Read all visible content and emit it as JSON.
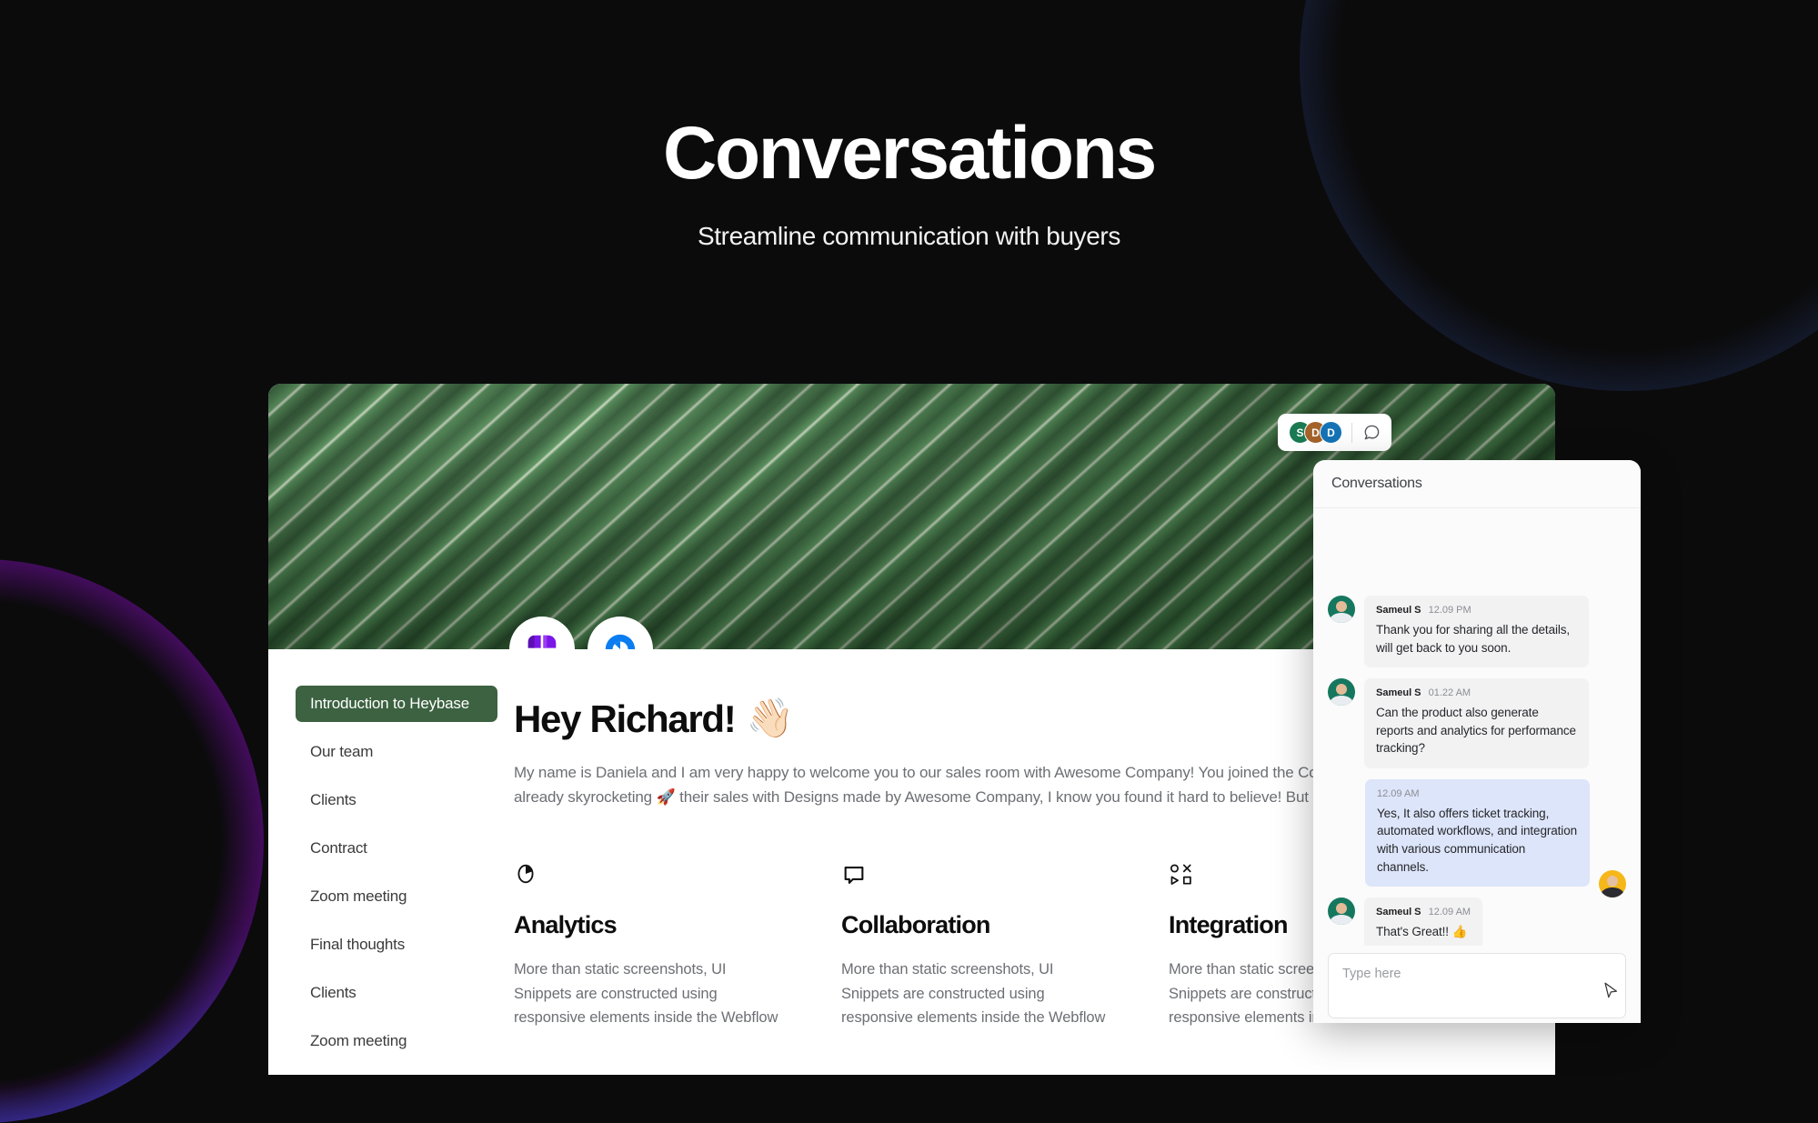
{
  "hero": {
    "title": "Conversations",
    "subtitle": "Streamline communication with buyers"
  },
  "colors": {
    "page_background": "#0b0b0c",
    "active_nav": "#3c6241",
    "outgoing_bubble": "#dde5fa",
    "incoming_bubble": "#f2f2f3",
    "banner_green": "#3f7543",
    "logo_purple": "#7b16e8",
    "logo_blue": "#0b7df0"
  },
  "banner": {
    "presence": {
      "avatars": [
        {
          "initial": "S",
          "color": "#1a7a52"
        },
        {
          "initial": "D",
          "color": "#a4622a"
        },
        {
          "initial": "D",
          "color": "#1573b5"
        }
      ],
      "chat_icon": "chat-bubble-icon"
    },
    "logos": [
      {
        "name": "heybase-logo",
        "icon": "clover-grid-icon"
      },
      {
        "name": "partner-logo",
        "icon": "blue-circle-icon"
      }
    ]
  },
  "sidebar": {
    "items": [
      {
        "label": "Introduction to Heybase",
        "active": true
      },
      {
        "label": "Our team",
        "active": false
      },
      {
        "label": "Clients",
        "active": false
      },
      {
        "label": "Contract",
        "active": false
      },
      {
        "label": "Zoom meeting",
        "active": false
      },
      {
        "label": "Final thoughts",
        "active": false
      },
      {
        "label": "Clients",
        "active": false
      },
      {
        "label": "Zoom meeting",
        "active": false
      }
    ]
  },
  "content": {
    "greeting": "Hey Richard!",
    "greeting_emoji": "👋🏻",
    "intro": "My name is Daniela and I am very happy to welcome you to our sales room with Awesome Company! You joined the Companies who are already skyrocketing 🚀 their sales with Designs made by Awesome Company, I know you found it hard to believe! But it is possible.",
    "features": [
      {
        "icon": "pie-chart-icon",
        "title": "Analytics",
        "body": "More than static screenshots, UI Snippets are constructed using responsive elements inside the Webflow"
      },
      {
        "icon": "speech-bubble-icon",
        "title": "Collaboration",
        "body": "More than static screenshots, UI Snippets are constructed using responsive elements inside the Webflow"
      },
      {
        "icon": "shapes-grid-icon",
        "title": "Integration",
        "body": "More than static screenshots, UI Snippets are constructed using responsive elements inside the Webflow"
      }
    ]
  },
  "chat": {
    "header_title": "Conversations",
    "messages": [
      {
        "direction": "in",
        "sender": "Sameul S",
        "time": "12.09 PM",
        "text": "Thank you for sharing all the details, will get back to you soon.",
        "avatar": "male-avatar"
      },
      {
        "direction": "in",
        "sender": "Sameul S",
        "time": "01.22 AM",
        "text": "Can the product also generate reports and analytics for performance tracking?",
        "avatar": "male-avatar"
      },
      {
        "direction": "out",
        "sender": "",
        "time": "12.09 AM",
        "text": "Yes, It also offers ticket tracking, automated workflows, and integration with various communication channels.",
        "avatar": "female-avatar"
      },
      {
        "direction": "in",
        "sender": "Sameul S",
        "time": "12.09 AM",
        "text": "That's Great!! 👍",
        "avatar": "male-avatar"
      }
    ],
    "input_placeholder": "Type here",
    "send_icon": "cursor-arrow-icon"
  }
}
